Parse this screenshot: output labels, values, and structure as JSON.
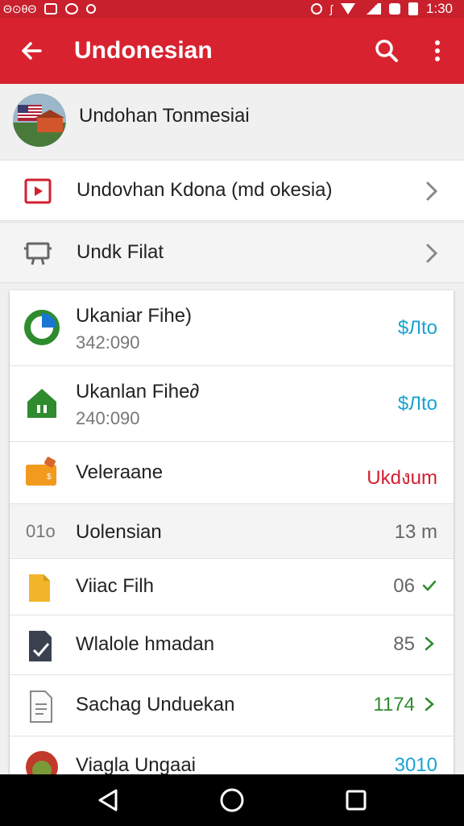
{
  "status_bar": {
    "left_text": "Θ⊙θΘ",
    "time": "1:30",
    "icons": [
      "image-icon",
      "circle-icon",
      "phone-icon",
      "alarm-icon",
      "bluetooth-icon",
      "wifi-icon",
      "signal-icon",
      "sim-icon",
      "battery-icon"
    ]
  },
  "app_bar": {
    "title": "Undonesian",
    "icons": [
      "back-arrow-icon",
      "search-icon",
      "more-vert-icon"
    ],
    "color": "#d9222f"
  },
  "header": {
    "title": "Undohan Tonmesiai"
  },
  "nav_rows": [
    {
      "label": "Undovhan Kdona (md okesia)",
      "icon": "video-icon"
    },
    {
      "label": "Undk Filat",
      "icon": "monitor-icon"
    }
  ],
  "list_items": [
    {
      "title": "Ukaniar Fihe)",
      "subtitle": "342:090",
      "value": "$Лto",
      "icon": "pie-chart-icon"
    },
    {
      "title": "Ukanlan Fihe∂",
      "subtitle": "240:090",
      "value": "$Лto",
      "icon": "home-icon"
    },
    {
      "title": "Veleraane",
      "value": "Ukdงum",
      "icon": "wallet-icon"
    },
    {
      "prefix": "01o",
      "title": "Uolensian",
      "value": "13 m"
    },
    {
      "title": "Viiac Filh",
      "value": "06",
      "icon": "folder-icon",
      "trail_icon": "check-icon"
    },
    {
      "title": "Wlalole hmadan",
      "value": "85",
      "icon": "document-pen-icon",
      "trail_icon": "chevron-right-icon"
    },
    {
      "title": "Sachag Unduekan",
      "value": "1174",
      "icon": "document-icon",
      "trail_icon": "chevron-right-icon"
    },
    {
      "title": "Viagla Ungaai",
      "value": "3010",
      "icon": "photo-icon"
    }
  ],
  "nav_bar": {
    "icons": [
      "back-triangle-icon",
      "home-circle-icon",
      "recents-square-icon"
    ]
  }
}
